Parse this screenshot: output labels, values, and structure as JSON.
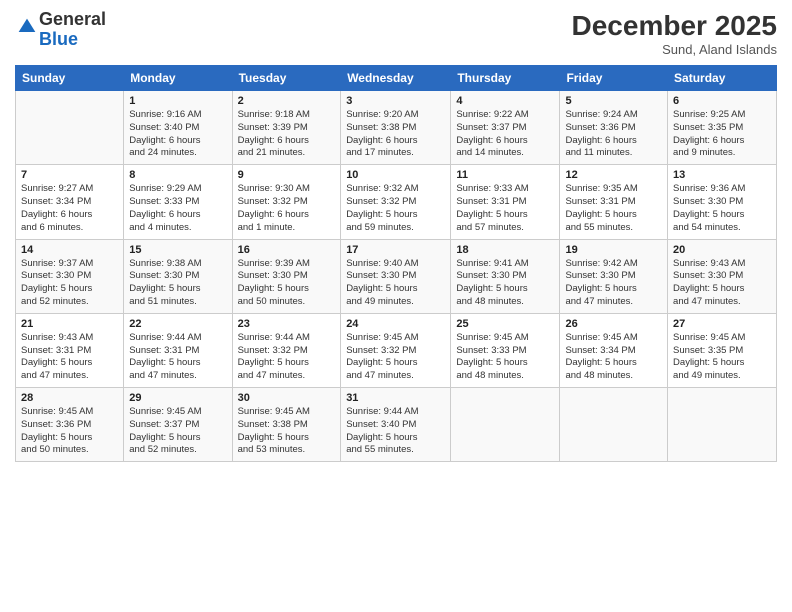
{
  "logo": {
    "general": "General",
    "blue": "Blue"
  },
  "header": {
    "month": "December 2025",
    "location": "Sund, Aland Islands"
  },
  "columns": [
    "Sunday",
    "Monday",
    "Tuesday",
    "Wednesday",
    "Thursday",
    "Friday",
    "Saturday"
  ],
  "weeks": [
    [
      {
        "day": "",
        "info": ""
      },
      {
        "day": "1",
        "info": "Sunrise: 9:16 AM\nSunset: 3:40 PM\nDaylight: 6 hours\nand 24 minutes."
      },
      {
        "day": "2",
        "info": "Sunrise: 9:18 AM\nSunset: 3:39 PM\nDaylight: 6 hours\nand 21 minutes."
      },
      {
        "day": "3",
        "info": "Sunrise: 9:20 AM\nSunset: 3:38 PM\nDaylight: 6 hours\nand 17 minutes."
      },
      {
        "day": "4",
        "info": "Sunrise: 9:22 AM\nSunset: 3:37 PM\nDaylight: 6 hours\nand 14 minutes."
      },
      {
        "day": "5",
        "info": "Sunrise: 9:24 AM\nSunset: 3:36 PM\nDaylight: 6 hours\nand 11 minutes."
      },
      {
        "day": "6",
        "info": "Sunrise: 9:25 AM\nSunset: 3:35 PM\nDaylight: 6 hours\nand 9 minutes."
      }
    ],
    [
      {
        "day": "7",
        "info": "Sunrise: 9:27 AM\nSunset: 3:34 PM\nDaylight: 6 hours\nand 6 minutes."
      },
      {
        "day": "8",
        "info": "Sunrise: 9:29 AM\nSunset: 3:33 PM\nDaylight: 6 hours\nand 4 minutes."
      },
      {
        "day": "9",
        "info": "Sunrise: 9:30 AM\nSunset: 3:32 PM\nDaylight: 6 hours\nand 1 minute."
      },
      {
        "day": "10",
        "info": "Sunrise: 9:32 AM\nSunset: 3:32 PM\nDaylight: 5 hours\nand 59 minutes."
      },
      {
        "day": "11",
        "info": "Sunrise: 9:33 AM\nSunset: 3:31 PM\nDaylight: 5 hours\nand 57 minutes."
      },
      {
        "day": "12",
        "info": "Sunrise: 9:35 AM\nSunset: 3:31 PM\nDaylight: 5 hours\nand 55 minutes."
      },
      {
        "day": "13",
        "info": "Sunrise: 9:36 AM\nSunset: 3:30 PM\nDaylight: 5 hours\nand 54 minutes."
      }
    ],
    [
      {
        "day": "14",
        "info": "Sunrise: 9:37 AM\nSunset: 3:30 PM\nDaylight: 5 hours\nand 52 minutes."
      },
      {
        "day": "15",
        "info": "Sunrise: 9:38 AM\nSunset: 3:30 PM\nDaylight: 5 hours\nand 51 minutes."
      },
      {
        "day": "16",
        "info": "Sunrise: 9:39 AM\nSunset: 3:30 PM\nDaylight: 5 hours\nand 50 minutes."
      },
      {
        "day": "17",
        "info": "Sunrise: 9:40 AM\nSunset: 3:30 PM\nDaylight: 5 hours\nand 49 minutes."
      },
      {
        "day": "18",
        "info": "Sunrise: 9:41 AM\nSunset: 3:30 PM\nDaylight: 5 hours\nand 48 minutes."
      },
      {
        "day": "19",
        "info": "Sunrise: 9:42 AM\nSunset: 3:30 PM\nDaylight: 5 hours\nand 47 minutes."
      },
      {
        "day": "20",
        "info": "Sunrise: 9:43 AM\nSunset: 3:30 PM\nDaylight: 5 hours\nand 47 minutes."
      }
    ],
    [
      {
        "day": "21",
        "info": "Sunrise: 9:43 AM\nSunset: 3:31 PM\nDaylight: 5 hours\nand 47 minutes."
      },
      {
        "day": "22",
        "info": "Sunrise: 9:44 AM\nSunset: 3:31 PM\nDaylight: 5 hours\nand 47 minutes."
      },
      {
        "day": "23",
        "info": "Sunrise: 9:44 AM\nSunset: 3:32 PM\nDaylight: 5 hours\nand 47 minutes."
      },
      {
        "day": "24",
        "info": "Sunrise: 9:45 AM\nSunset: 3:32 PM\nDaylight: 5 hours\nand 47 minutes."
      },
      {
        "day": "25",
        "info": "Sunrise: 9:45 AM\nSunset: 3:33 PM\nDaylight: 5 hours\nand 48 minutes."
      },
      {
        "day": "26",
        "info": "Sunrise: 9:45 AM\nSunset: 3:34 PM\nDaylight: 5 hours\nand 48 minutes."
      },
      {
        "day": "27",
        "info": "Sunrise: 9:45 AM\nSunset: 3:35 PM\nDaylight: 5 hours\nand 49 minutes."
      }
    ],
    [
      {
        "day": "28",
        "info": "Sunrise: 9:45 AM\nSunset: 3:36 PM\nDaylight: 5 hours\nand 50 minutes."
      },
      {
        "day": "29",
        "info": "Sunrise: 9:45 AM\nSunset: 3:37 PM\nDaylight: 5 hours\nand 52 minutes."
      },
      {
        "day": "30",
        "info": "Sunrise: 9:45 AM\nSunset: 3:38 PM\nDaylight: 5 hours\nand 53 minutes."
      },
      {
        "day": "31",
        "info": "Sunrise: 9:44 AM\nSunset: 3:40 PM\nDaylight: 5 hours\nand 55 minutes."
      },
      {
        "day": "",
        "info": ""
      },
      {
        "day": "",
        "info": ""
      },
      {
        "day": "",
        "info": ""
      }
    ]
  ]
}
